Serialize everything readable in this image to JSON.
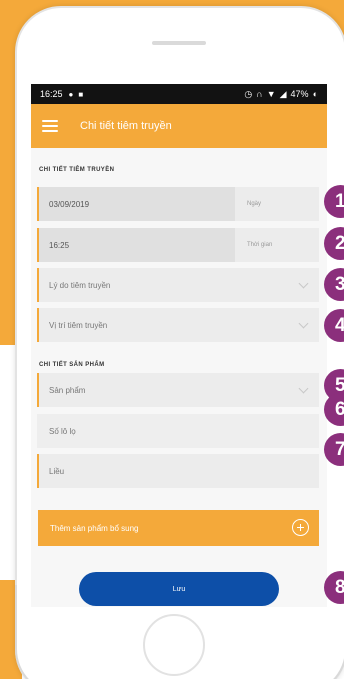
{
  "status_bar": {
    "time": "16:25",
    "battery": "47%",
    "icons": [
      "spotify-icon",
      "image-icon",
      "alarm-icon",
      "headphones-icon",
      "wifi-icon",
      "signal-icon",
      "battery-icon"
    ]
  },
  "app_bar": {
    "title": "Chi tiết tiêm truyền"
  },
  "section1": {
    "label": "CHI TIẾT TIÊM TRUYỀN"
  },
  "date_row": {
    "value": "03/09/2019",
    "suffix": "Ngày"
  },
  "time_row": {
    "value": "16:25",
    "suffix": "Thời gian"
  },
  "reason_field": {
    "placeholder": "Lý do tiêm truyền"
  },
  "position_field": {
    "placeholder": "Vị trí tiêm truyền"
  },
  "section2": {
    "label": "CHI TIẾT SẢN PHẨM"
  },
  "product_field": {
    "placeholder": "Sản phẩm"
  },
  "lot_field": {
    "placeholder": "Số lô lọ"
  },
  "dose_field": {
    "placeholder": "Liều"
  },
  "add_button": {
    "label": "Thêm sản phẩm bổ sung"
  },
  "save_button": {
    "label": "Lưu"
  },
  "badges": [
    "1",
    "2",
    "3",
    "4",
    "5",
    "6",
    "7",
    "8"
  ],
  "colors": {
    "accent": "#f4a93a",
    "primary": "#0d4fa8",
    "badge": "#8b2f7c"
  }
}
